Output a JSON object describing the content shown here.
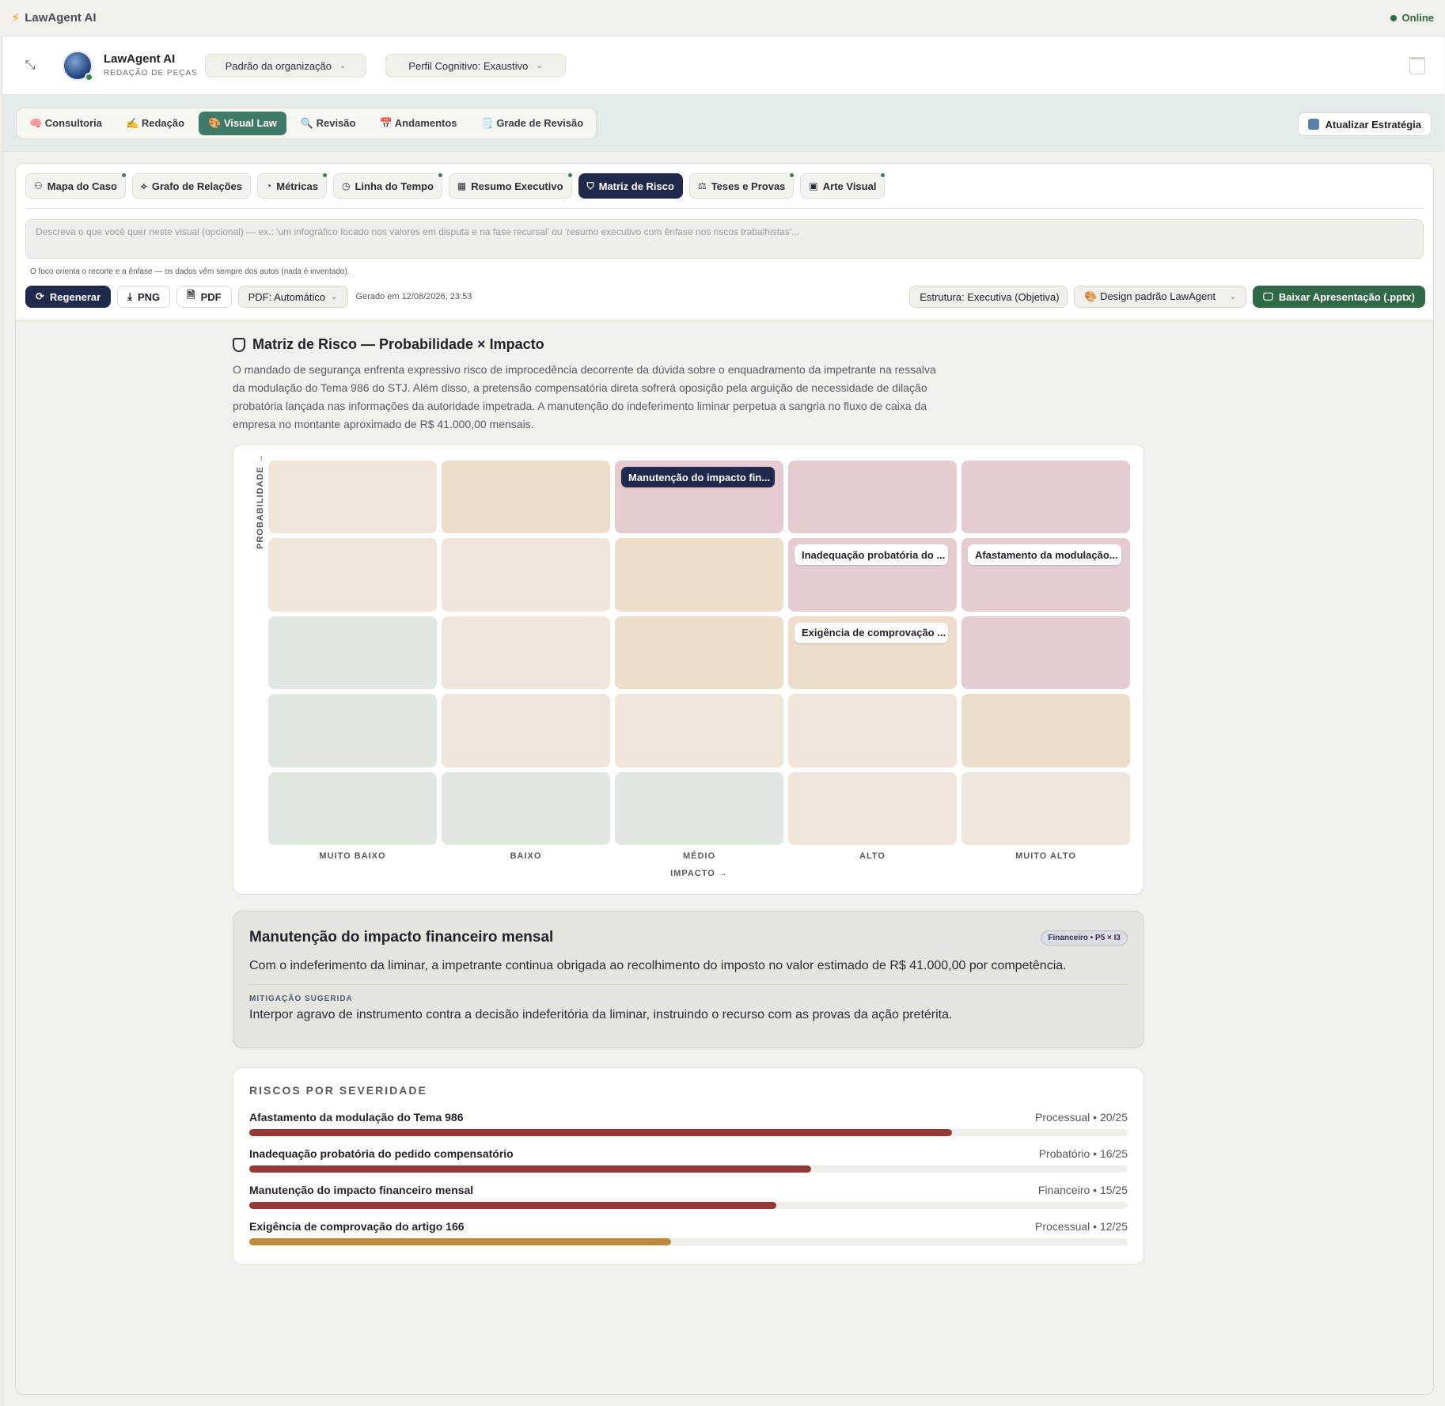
{
  "topbar": {
    "brand": "LawAgent AI",
    "status": "Online"
  },
  "header": {
    "agent_name": "LawAgent AI",
    "agent_sub": "REDAÇÃO DE PEÇAS",
    "org_select": "Padrão da organização",
    "profile_select": "Perfil Cognitivo: Exaustivo"
  },
  "main_tabs": [
    {
      "label": "🧠 Consultoria"
    },
    {
      "label": "✍️ Redação"
    },
    {
      "label": "🎨 Visual Law"
    },
    {
      "label": "🔍 Revisão"
    },
    {
      "label": "📅 Andamentos"
    },
    {
      "label": "🗒️ Grade de Revisão"
    }
  ],
  "strategy_button": "Atualizar Estratégia",
  "sub_tabs": [
    {
      "label": "Mapa do Caso",
      "icon": "⚇"
    },
    {
      "label": "Grafo de Relações",
      "icon": "⟡"
    },
    {
      "label": "Métricas",
      "icon": "◔"
    },
    {
      "label": "Linha do Tempo",
      "icon": "◷"
    },
    {
      "label": "Resumo Executivo",
      "icon": "▦"
    },
    {
      "label": "Matriz de Risco",
      "icon": "⛉"
    },
    {
      "label": "Teses e Provas",
      "icon": "⚖"
    },
    {
      "label": "Arte Visual",
      "icon": "▣"
    }
  ],
  "prompt": {
    "placeholder": "Descreva o que você quer neste visual (opcional) — ex.: 'um infográfico focado nos valores em disputa e na fase recursal' ou 'resumo executivo com ênfase nos riscos trabalhistas'...",
    "note": "O foco orienta o recorte e a ênfase — os dados vêm sempre dos autos (nada é inventado)."
  },
  "actions": {
    "regenerate": "Regenerar",
    "png": "PNG",
    "pdf": "PDF",
    "pdf_mode": "PDF: Automático",
    "generated": "Gerado em 12/08/2026, 23:53",
    "structure": "Estrutura: Executiva (Objetiva)",
    "design": "🎨 Design padrão LawAgent",
    "download": "Baixar Apresentação (.pptx)"
  },
  "matrix": {
    "title": "Matriz de Risco — Probabilidade × Impacto",
    "summary": "O mandado de segurança enfrenta expressivo risco de improcedência decorrente da dúvida sobre o enquadramento da impetrante na ressalva da modulação do Tema 986 do STJ. Além disso, a pretensão compensatória direta sofrerá oposição pela arguição de necessidade de dilação probatória lançada nas informações da autoridade impetrada. A manutenção do indeferimento liminar perpetua a sangria no fluxo de caixa da empresa no montante aproximado de R$ 41.000,00 mensais.",
    "y_axis": "PROBABILIDADE →",
    "x_axis": "IMPACTO →",
    "impact_levels": [
      "MUITO BAIXO",
      "BAIXO",
      "MÉDIO",
      "ALTO",
      "MUITO ALTO"
    ],
    "chips": {
      "p5i3": "Manutenção do impacto fin...",
      "p4i4": "Inadequação probatória do ...",
      "p4i5": "Afastamento da modulação...",
      "p3i4": "Exigência de comprovação ..."
    }
  },
  "detail": {
    "title": "Manutenção do impacto financeiro mensal",
    "badge": "Financeiro • P5 × I3",
    "description": "Com o indeferimento da liminar, a impetrante continua obrigada ao recolhimento do imposto no valor estimado de R$ 41.000,00 por competência.",
    "mitigation_label": "MITIGAÇÃO SUGERIDA",
    "mitigation": "Interpor agravo de instrumento contra a decisão indeferitória da liminar, instruindo o recurso com as provas da ação pretérita."
  },
  "severity": {
    "title": "RISCOS POR SEVERIDADE",
    "items": [
      {
        "name": "Afastamento da modulação do Tema 986",
        "meta": "Processual • 20/25",
        "score": 20,
        "max": 25,
        "color": "#943838"
      },
      {
        "name": "Inadequação probatória do pedido compensatório",
        "meta": "Probatório • 16/25",
        "score": 16,
        "max": 25,
        "color": "#943838"
      },
      {
        "name": "Manutenção do impacto financeiro mensal",
        "meta": "Financeiro • 15/25",
        "score": 15,
        "max": 25,
        "color": "#943838"
      },
      {
        "name": "Exigência de comprovação do artigo 166",
        "meta": "Processual • 12/25",
        "score": 12,
        "max": 25,
        "color": "#bd8a3c"
      }
    ]
  }
}
